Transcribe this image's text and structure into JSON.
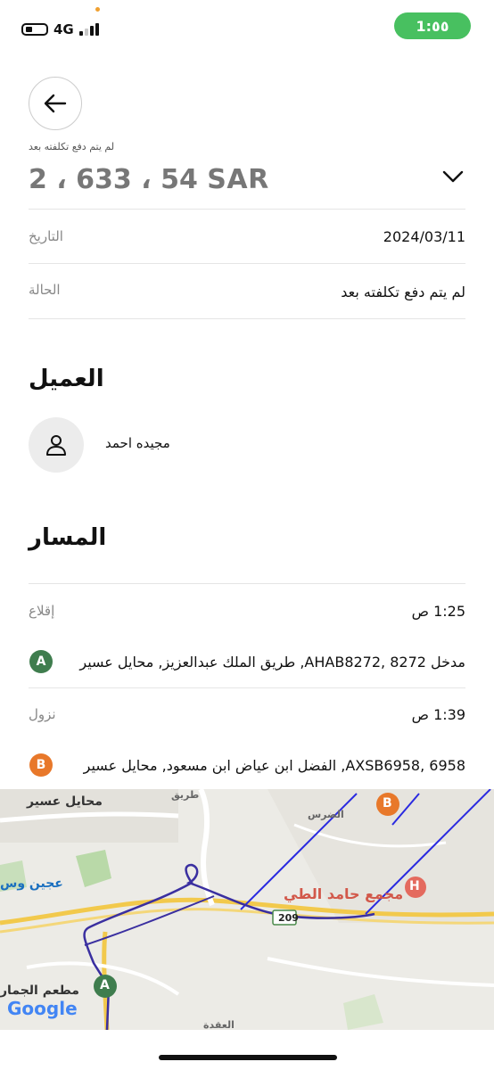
{
  "status_bar": {
    "network": "4G",
    "time": "1:٥٥"
  },
  "header": {
    "unpaid_note": "لم يتم دفع تكلفته بعد",
    "amount": "2 ، 633 ، 54 SAR"
  },
  "details": [
    {
      "label": "التاريخ",
      "value": "2024/03/11"
    },
    {
      "label": "الحالة",
      "value": "لم يتم دفع تكلفته بعد"
    }
  ],
  "customer": {
    "section_title": "العميل",
    "name": "مجيده احمد"
  },
  "route": {
    "section_title": "المسار",
    "pickup": {
      "label": "إقلاع",
      "time": "1:25 ص",
      "marker": "A",
      "address": "مدخل AHAB8272, 8272, طريق الملك عبدالعزيز, محايل عسير"
    },
    "dropoff": {
      "label": "نزول",
      "time": "1:39 ص",
      "marker": "B",
      "address": "AXSB6958, 6958, الفضل ابن عياض ابن مسعود, محايل عسير"
    }
  },
  "map": {
    "labels": {
      "city": "محايل عسير",
      "district": "الضرس",
      "place": "مجمع حامد الطي",
      "restaurant": "مطعم الجمار",
      "area1": "عجين وس",
      "area2": "طريق",
      "area3": "العقدة",
      "road": "209"
    },
    "attribution": "Google",
    "marker_a": "A",
    "marker_b": "B",
    "hospital": "H"
  },
  "colors": {
    "accent_green": "#48c060",
    "marker_a": "#3f7d4e",
    "marker_b": "#e8782a",
    "route": "#3a2fa0"
  }
}
